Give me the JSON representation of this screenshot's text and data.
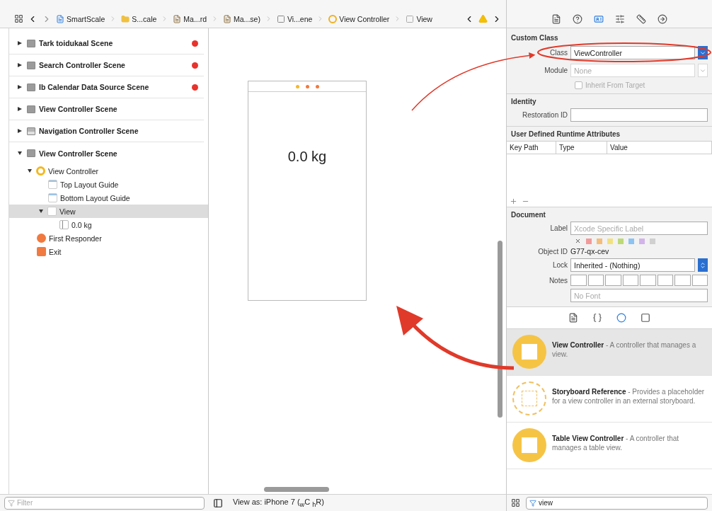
{
  "breadcrumb": [
    {
      "kind": "project",
      "label": "SmartScale"
    },
    {
      "kind": "folder",
      "label": "S...cale"
    },
    {
      "kind": "file",
      "label": "Ma...rd"
    },
    {
      "kind": "file",
      "label": "Ma...se)"
    },
    {
      "kind": "scene",
      "label": "Vi...ene"
    },
    {
      "kind": "controller",
      "label": "View Controller"
    },
    {
      "kind": "view",
      "label": "View"
    }
  ],
  "inspector_tabs": [
    {
      "selected": false
    },
    {
      "selected": false
    },
    {
      "selected": true
    },
    {
      "selected": false
    },
    {
      "selected": false
    },
    {
      "selected": false
    }
  ],
  "outline": {
    "scenes": [
      {
        "label": "Tark toidukaal Scene",
        "kind": "scene",
        "expanded": false,
        "error": true
      },
      {
        "label": "Search Controller Scene",
        "kind": "scene",
        "expanded": false,
        "error": true
      },
      {
        "label": "Ib Calendar Data Source Scene",
        "kind": "scene",
        "expanded": false,
        "error": true
      },
      {
        "label": "View Controller Scene",
        "kind": "scene",
        "expanded": false,
        "error": false
      },
      {
        "label": "Navigation Controller Scene",
        "kind": "nav",
        "expanded": false,
        "error": false
      },
      {
        "label": "View Controller Scene",
        "kind": "scene",
        "expanded": true,
        "error": false,
        "children": [
          {
            "label": "View Controller",
            "kind": "controller",
            "expanded": true,
            "selected": false,
            "children": [
              {
                "label": "Top Layout Guide",
                "kind": "guide",
                "selected": false
              },
              {
                "label": "Bottom Layout Guide",
                "kind": "guide",
                "selected": false
              },
              {
                "label": "View",
                "kind": "view",
                "expanded": true,
                "selected": true,
                "children": [
                  {
                    "label": "0.0 kg",
                    "kind": "label",
                    "selected": false
                  }
                ]
              }
            ]
          },
          {
            "label": "First Responder",
            "kind": "responder",
            "selected": false
          },
          {
            "label": "Exit",
            "kind": "exit",
            "selected": false
          }
        ]
      }
    ],
    "filter_placeholder": "Filter"
  },
  "canvas": {
    "weight_label": "0.0 kg",
    "view_as": "View as: iPhone 7 ($_{w}$C $_{h}$R)"
  },
  "custom_class": {
    "title": "Custom Class",
    "class_label": "Class",
    "class_value": "ViewController",
    "module_label": "Module",
    "module_placeholder": "None",
    "inherit_label": "Inherit From Target",
    "inherit_checked": false
  },
  "identity": {
    "title": "Identity",
    "restoration_label": "Restoration ID"
  },
  "runtime_attributes": {
    "title": "User Defined Runtime Attributes",
    "columns": [
      "Key Path",
      "Type",
      "Value"
    ]
  },
  "document": {
    "title": "Document",
    "label_label": "Label",
    "label_placeholder": "Xcode Specific Label",
    "colors": [
      {
        "color": "#f29a9a"
      },
      {
        "color": "#f5bd7a"
      },
      {
        "color": "#f2e27f"
      },
      {
        "color": "#bcd978"
      },
      {
        "color": "#8cc3f2"
      },
      {
        "color": "#d2b3ea"
      },
      {
        "color": "#d0d0d0"
      }
    ],
    "object_id_label": "Object ID",
    "object_id": "G77-qx-cev",
    "lock_label": "Lock",
    "lock_value": "Inherited - (Nothing)",
    "notes_label": "Notes",
    "font_placeholder": "No Font"
  },
  "library_tabs": [
    {
      "selected": false
    },
    {
      "selected": false
    },
    {
      "selected": true
    },
    {
      "selected": false
    }
  ],
  "library": [
    {
      "kind": "controller",
      "text": "**View Controller** - A controller that manages a view.",
      "selected": true
    },
    {
      "kind": "reference",
      "text": "**Storyboard Reference** - Provides a placeholder for a view controller in an external storyboard.",
      "selected": false
    },
    {
      "kind": "table",
      "text": "**Table View Controller** - A controller that manages a table view.",
      "selected": false
    }
  ],
  "library_filter": "view"
}
